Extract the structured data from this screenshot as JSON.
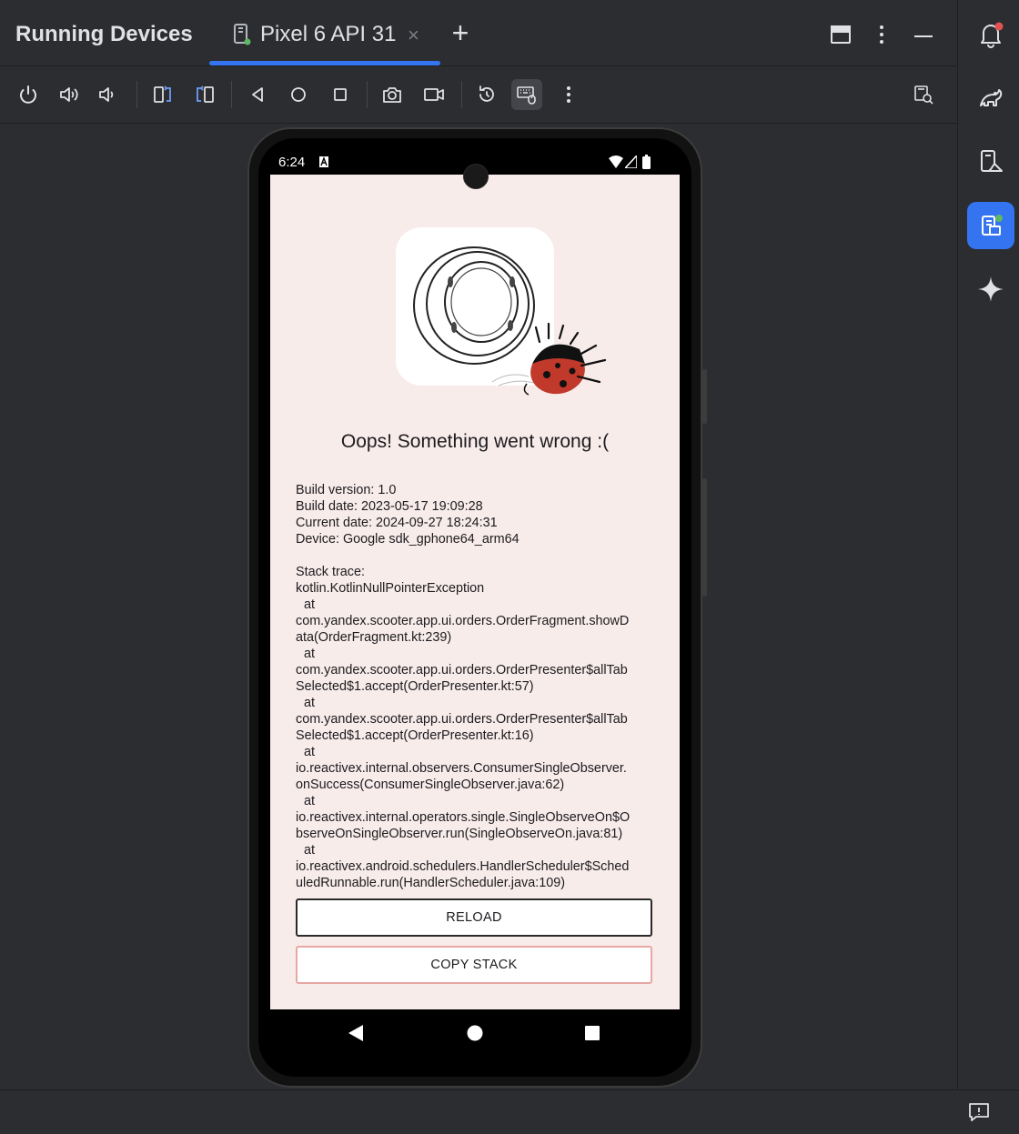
{
  "header": {
    "panel_title": "Running Devices",
    "tab_label": "Pixel 6 API 31",
    "tab_close": "×",
    "add_tab": "+"
  },
  "toolbar": {
    "items": [
      "power-icon",
      "volume-up-icon",
      "volume-down-icon",
      "rotate-left-icon",
      "rotate-right-icon",
      "back-icon",
      "home-icon",
      "overview-icon",
      "screenshot-icon",
      "screen-record-icon",
      "reset-icon",
      "keyboard-mouse-icon",
      "more-icon"
    ],
    "right_item": "device-explorer-icon"
  },
  "sidebar": {
    "items": [
      "notifications-icon",
      "gradle-icon",
      "device-manager-icon",
      "running-devices-icon",
      "gemini-icon"
    ]
  },
  "device": {
    "status_time": "6:24",
    "title": "Oops! Something went wrong :(",
    "details": [
      "Build version: 1.0",
      "Build date: 2023-05-17 19:09:28",
      "Current date: 2024-09-27 18:24:31",
      "Device: Google sdk_gphone64_arm64"
    ],
    "trace_lines": [
      "Stack trace:",
      "kotlin.KotlinNullPointerException",
      "at",
      "com.yandex.scooter.app.ui.orders.OrderFragment.showD",
      "ata(OrderFragment.kt:239)",
      "at",
      "com.yandex.scooter.app.ui.orders.OrderPresenter$allTab",
      "Selected$1.accept(OrderPresenter.kt:57)",
      "at",
      "com.yandex.scooter.app.ui.orders.OrderPresenter$allTab",
      "Selected$1.accept(OrderPresenter.kt:16)",
      "at",
      "io.reactivex.internal.observers.ConsumerSingleObserver.",
      "onSuccess(ConsumerSingleObserver.java:62)",
      "at",
      "io.reactivex.internal.operators.single.SingleObserveOn$O",
      "bserveOnSingleObserver.run(SingleObserveOn.java:81)",
      "at",
      "io.reactivex.android.schedulers.HandlerScheduler$Sched",
      "uledRunnable.run(HandlerScheduler.java:109)"
    ],
    "reload_label": "RELOAD",
    "copy_stack_label": "COPY STACK"
  },
  "colors": {
    "ide_background": "#2b2d30",
    "accent": "#3574f0",
    "app_background": "#f8ecea",
    "ladybug_red": "#c0392b"
  }
}
